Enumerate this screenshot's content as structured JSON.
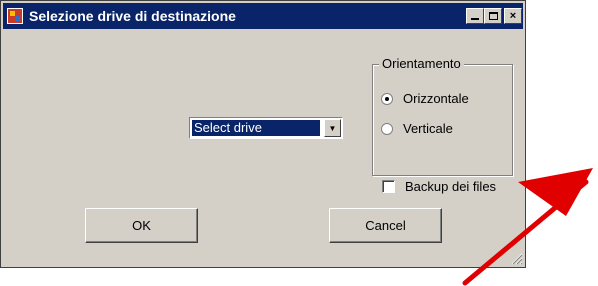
{
  "window": {
    "title": "Selezione drive di destinazione",
    "icon": "app-window-icon",
    "controls": {
      "minimize": "minimize-icon",
      "maximize": "maximize-icon",
      "close": "×"
    }
  },
  "drive_select": {
    "selected": "Select drive",
    "arrow": "▼"
  },
  "orientation": {
    "legend": "Orientamento",
    "options": [
      {
        "label": "Orizzontale",
        "selected": true
      },
      {
        "label": "Verticale",
        "selected": false
      }
    ]
  },
  "backup_checkbox": {
    "label": "Backup dei files",
    "checked": false
  },
  "buttons": {
    "ok": "OK",
    "cancel": "Cancel"
  },
  "annotation": {
    "type": "red-arrow",
    "color": "#e00000",
    "points_to": "backup-checkbox"
  }
}
